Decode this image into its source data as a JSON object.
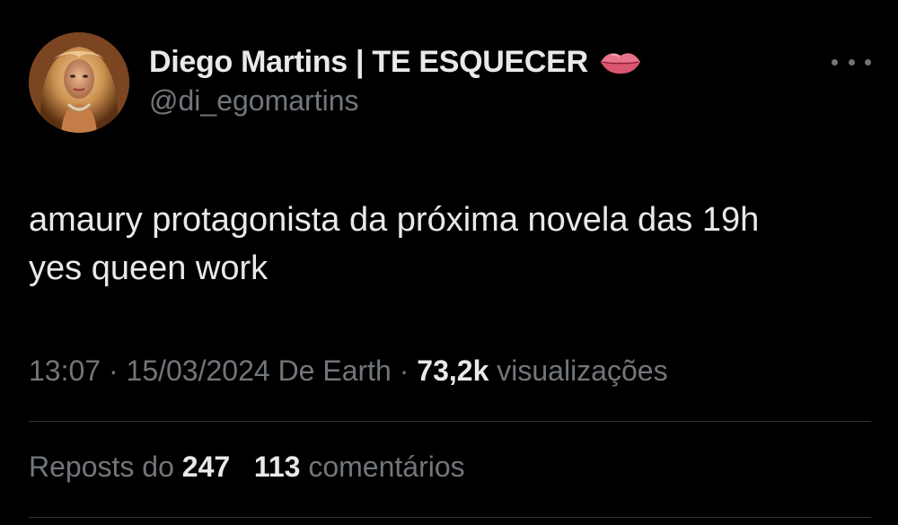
{
  "author": {
    "display_name": "Diego Martins | TE ESQUECER",
    "handle": "@di_egomartins",
    "name_emoji": "lips-icon"
  },
  "tweet": {
    "lines": [
      "amaury protagonista da próxima novela das 19h",
      "yes queen work"
    ]
  },
  "meta": {
    "time": "13:07",
    "sep1": "·",
    "date": "15/03/2024",
    "source": "De Earth",
    "sep2": "·",
    "views_count": "73,2k",
    "views_label": "visualizações"
  },
  "stats": {
    "reposts_label": "Reposts do",
    "reposts_count": "247",
    "comments_count": "113",
    "comments_label": "comentários"
  },
  "icons": {
    "more": "more-options-icon"
  },
  "colors": {
    "background": "#000000",
    "primary_text": "#e7e9ea",
    "secondary_text": "#71767b",
    "divider": "#2f3336"
  }
}
